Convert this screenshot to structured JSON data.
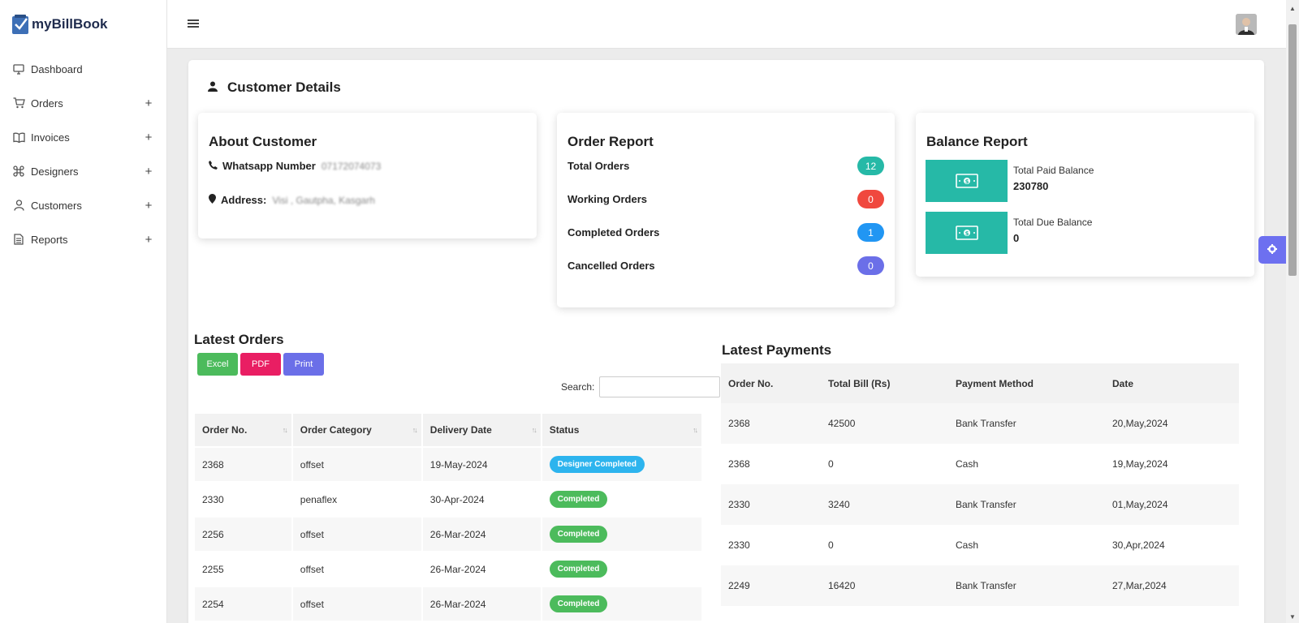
{
  "brand": {
    "name": "myBillBook"
  },
  "sidebar": {
    "items": [
      {
        "label": "Dashboard",
        "icon": "monitor-icon",
        "expandable": false
      },
      {
        "label": "Orders",
        "icon": "cart-icon",
        "expandable": true
      },
      {
        "label": "Invoices",
        "icon": "book-icon",
        "expandable": true
      },
      {
        "label": "Designers",
        "icon": "command-icon",
        "expandable": true
      },
      {
        "label": "Customers",
        "icon": "user-icon",
        "expandable": true
      },
      {
        "label": "Reports",
        "icon": "file-icon",
        "expandable": true
      }
    ],
    "plus": "+"
  },
  "page": {
    "title": "Customer Details"
  },
  "about": {
    "title": "About Customer",
    "whatsapp_label": "Whatsapp Number",
    "whatsapp_value": "07172074073",
    "address_label": "Address:",
    "address_value": "Visi  ,  Gautpha, Kasgarh"
  },
  "order_report": {
    "title": "Order Report",
    "rows": [
      {
        "label": "Total Orders",
        "value": "12",
        "color": "#26b9a7"
      },
      {
        "label": "Working Orders",
        "value": "0",
        "color": "#f0483e"
      },
      {
        "label": "Completed Orders",
        "value": "1",
        "color": "#2196f3"
      },
      {
        "label": "Cancelled Orders",
        "value": "0",
        "color": "#6b6fe8"
      }
    ]
  },
  "balance_report": {
    "title": "Balance Report",
    "accent": "#26b9a7",
    "rows": [
      {
        "label": "Total Paid Balance",
        "value": "230780"
      },
      {
        "label": "Total Due Balance",
        "value": "0"
      }
    ]
  },
  "latest_orders": {
    "title": "Latest Orders",
    "buttons": [
      {
        "label": "Excel",
        "color": "#4cbb5c"
      },
      {
        "label": "PDF",
        "color": "#e91e63"
      },
      {
        "label": "Print",
        "color": "#6b6fe8"
      }
    ],
    "search_label": "Search:",
    "columns": [
      "Order No.",
      "Order Category",
      "Delivery Date",
      "Status"
    ],
    "rows": [
      {
        "order_no": "2368",
        "category": "offset",
        "delivery": "19-May-2024",
        "status": "Designer Completed",
        "status_color": "#2db4ee"
      },
      {
        "order_no": "2330",
        "category": "penaflex",
        "delivery": "30-Apr-2024",
        "status": "Completed",
        "status_color": "#4cbb5c"
      },
      {
        "order_no": "2256",
        "category": "offset",
        "delivery": "26-Mar-2024",
        "status": "Completed",
        "status_color": "#4cbb5c"
      },
      {
        "order_no": "2255",
        "category": "offset",
        "delivery": "26-Mar-2024",
        "status": "Completed",
        "status_color": "#4cbb5c"
      },
      {
        "order_no": "2254",
        "category": "offset",
        "delivery": "26-Mar-2024",
        "status": "Completed",
        "status_color": "#4cbb5c"
      }
    ]
  },
  "latest_payments": {
    "title": "Latest Payments",
    "columns": [
      "Order No.",
      "Total Bill (Rs)",
      "Payment Method",
      "Date"
    ],
    "rows": [
      {
        "order_no": "2368",
        "total": "42500",
        "method": "Bank Transfer",
        "date": "20,May,2024"
      },
      {
        "order_no": "2368",
        "total": "0",
        "method": "Cash",
        "date": "19,May,2024"
      },
      {
        "order_no": "2330",
        "total": "3240",
        "method": "Bank Transfer",
        "date": "01,May,2024"
      },
      {
        "order_no": "2330",
        "total": "0",
        "method": "Cash",
        "date": "30,Apr,2024"
      },
      {
        "order_no": "2249",
        "total": "16420",
        "method": "Bank Transfer",
        "date": "27,Mar,2024"
      }
    ]
  }
}
